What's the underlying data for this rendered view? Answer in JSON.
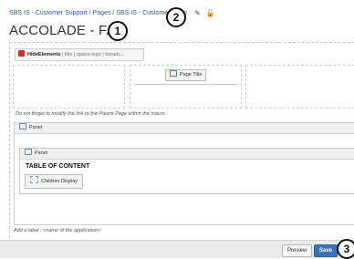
{
  "breadcrumb": {
    "items": [
      "SBS IS - Customer Support",
      "Pages",
      "SBS IS - Customer Supp"
    ],
    "separator": "/"
  },
  "header_icons": [
    "pencil-icon",
    "lock-icon"
  ],
  "page": {
    "title": "ACCOLADE - FAQ"
  },
  "callouts": [
    "1",
    "2",
    "3"
  ],
  "macro": {
    "name": "HideElements",
    "params": "| title | space-logo | breadc..."
  },
  "layout": {
    "page_title_button": "Page Title"
  },
  "note": "Do not forget to modify the link to the Parent Page within the macro.",
  "panel_outer": {
    "title": "Panel"
  },
  "panel_inner": {
    "title": "Panel",
    "heading": "TABLE OF CONTENT",
    "children_button": "Children Display"
  },
  "label_prompt": "Add a label : <name of the application>",
  "footer": {
    "preview_label": "Preview",
    "save_label": "Save"
  },
  "colors": {
    "link": "#2a5db0",
    "save_button": "#3b73b9",
    "footer_bg": "#eaeaea",
    "hide_icon": "#c0392b"
  }
}
